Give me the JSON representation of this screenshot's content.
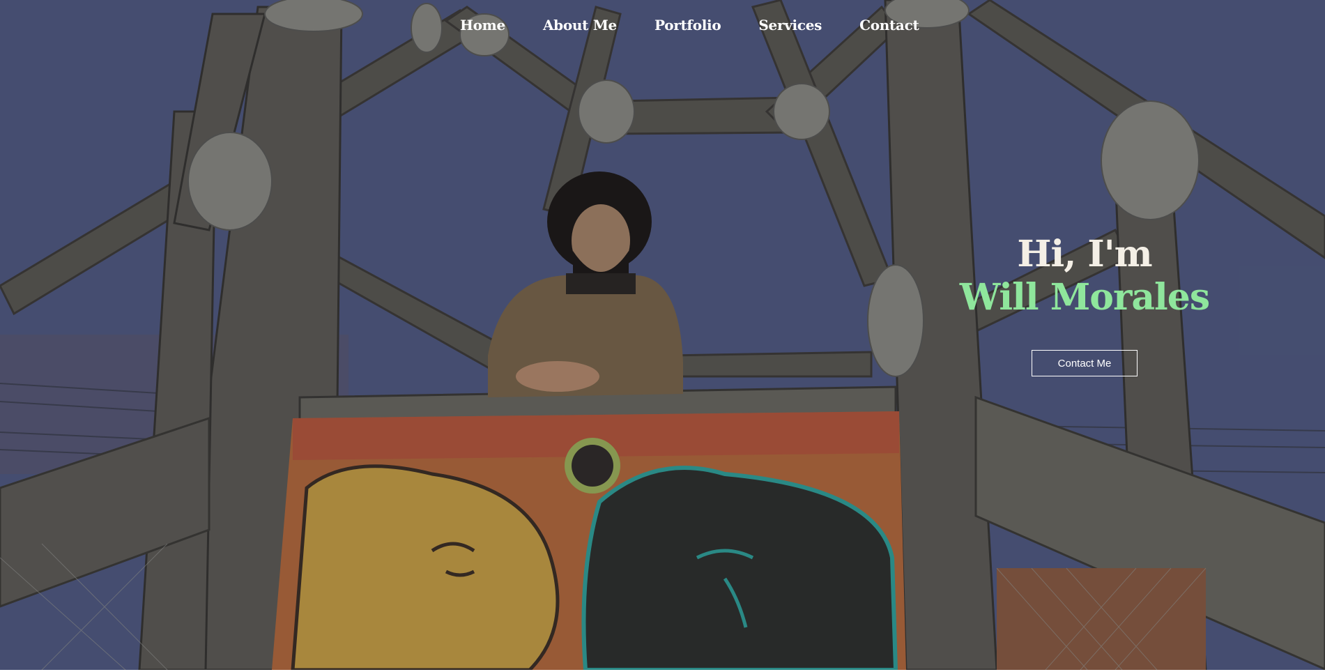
{
  "nav": {
    "items": [
      {
        "label": "Home"
      },
      {
        "label": "About Me"
      },
      {
        "label": "Portfolio"
      },
      {
        "label": "Services"
      },
      {
        "label": "Contact"
      }
    ]
  },
  "hero": {
    "greeting": "Hi, I'm",
    "name": "Will Morales",
    "cta_label": "Contact Me",
    "name_color": "#8fe69c",
    "background_image": "man-on-wooden-rope-tower-photo"
  }
}
